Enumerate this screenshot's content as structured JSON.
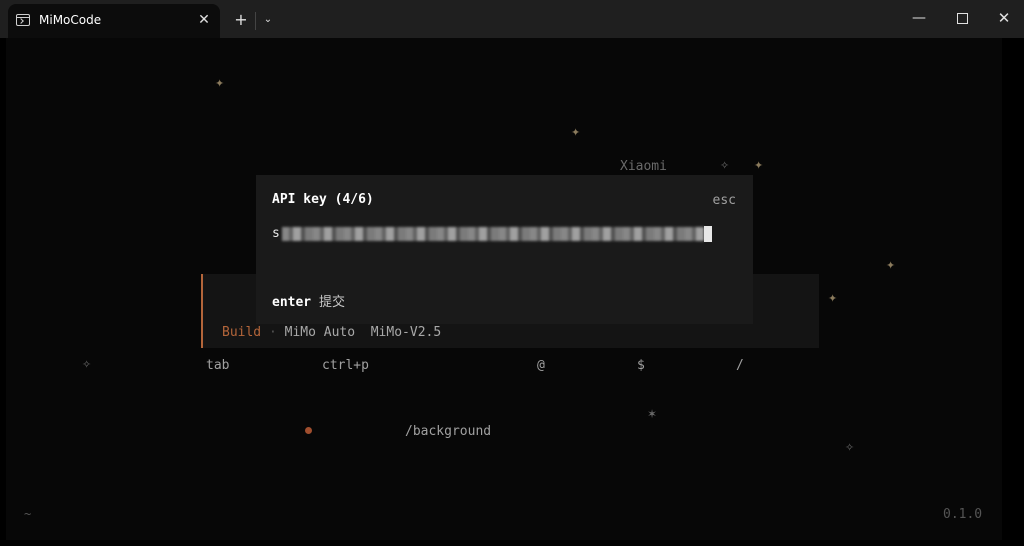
{
  "window": {
    "tab_title": "MiMoCode",
    "tab_close": "✕",
    "new_tab": "+",
    "tab_dropdown": "⌄",
    "minimize": "—",
    "close": "✕"
  },
  "terminal": {
    "brand": "Xiaomi",
    "mode": {
      "build": "Build",
      "separator": "·",
      "agent": "MiMo Auto",
      "model": "MiMo-V2.5"
    },
    "shortcuts": [
      {
        "key": "tab"
      },
      {
        "key": "ctrl+p"
      },
      {
        "key": "@"
      },
      {
        "key": "$"
      },
      {
        "key": "/"
      }
    ],
    "background_command": "/background",
    "cwd": "~",
    "version": "0.1.0"
  },
  "dialog": {
    "title": "API key (4/6)",
    "esc": "esc",
    "key_prefix": "s",
    "hint_key": "enter",
    "hint_label": "提交"
  },
  "icons": {
    "terminal_tab_icon": "terminal-icon",
    "star_brown": "✦",
    "star_outline": "✧",
    "asterisk": "✶"
  },
  "colors": {
    "accent": "#b3653a",
    "background": "#070707",
    "dialog_bg": "#1a1a1a",
    "titlebar": "#1f1f1f"
  }
}
